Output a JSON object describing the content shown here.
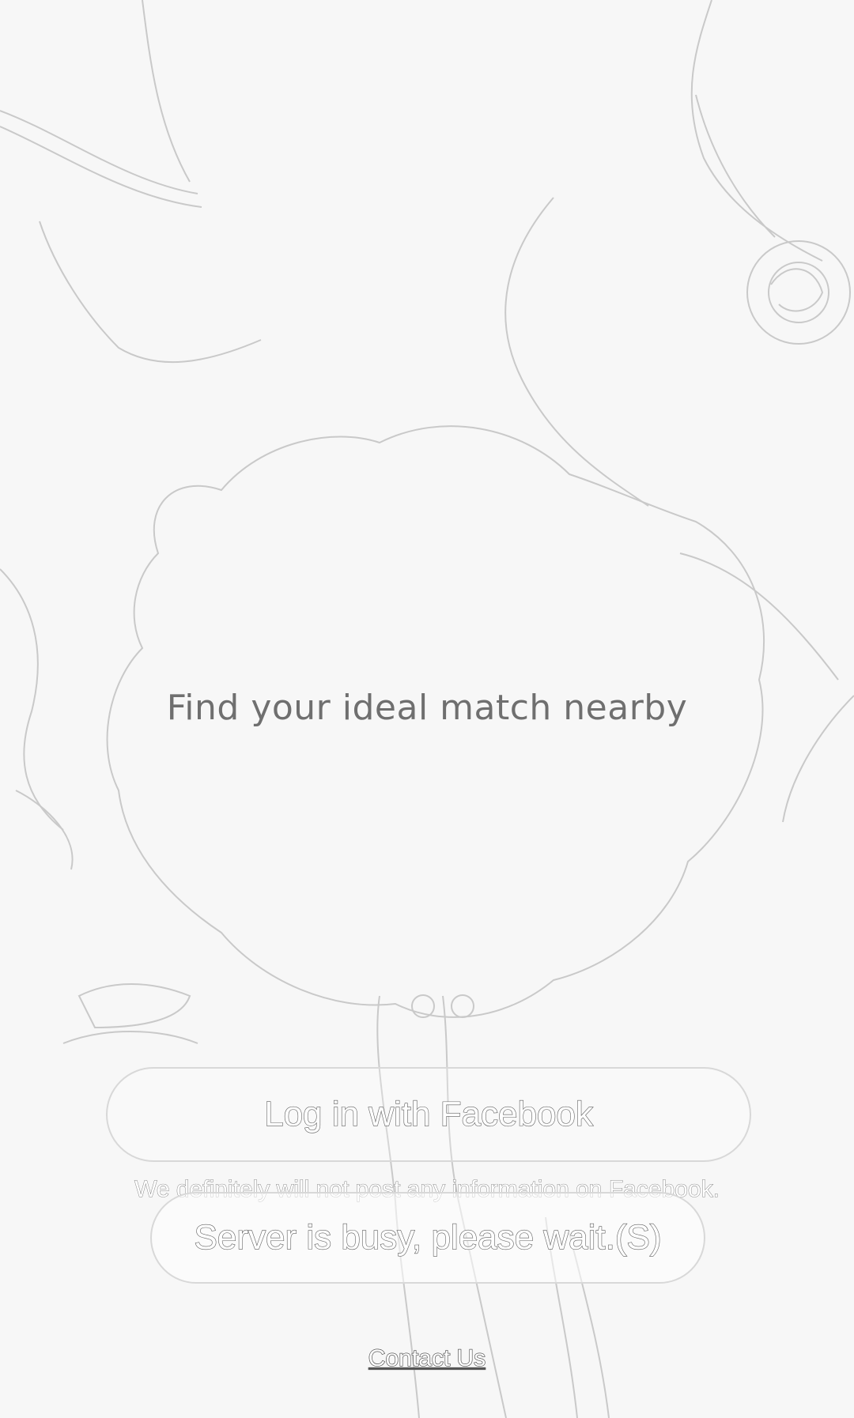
{
  "tagline": "Find your ideal match nearby",
  "login": {
    "facebook_label": "Log in with Facebook",
    "disclaimer": "We definitely will not post any information on Facebook.",
    "server_status": "Server is busy, please wait.(S)"
  },
  "footer": {
    "contact_label": "Contact Us"
  },
  "colors": {
    "background": "#f7f7f7",
    "tagline_text": "#6f6f6f",
    "button_border": "#d8d8d8",
    "outline_text": "#555555"
  },
  "icons": [
    "background-photo"
  ]
}
